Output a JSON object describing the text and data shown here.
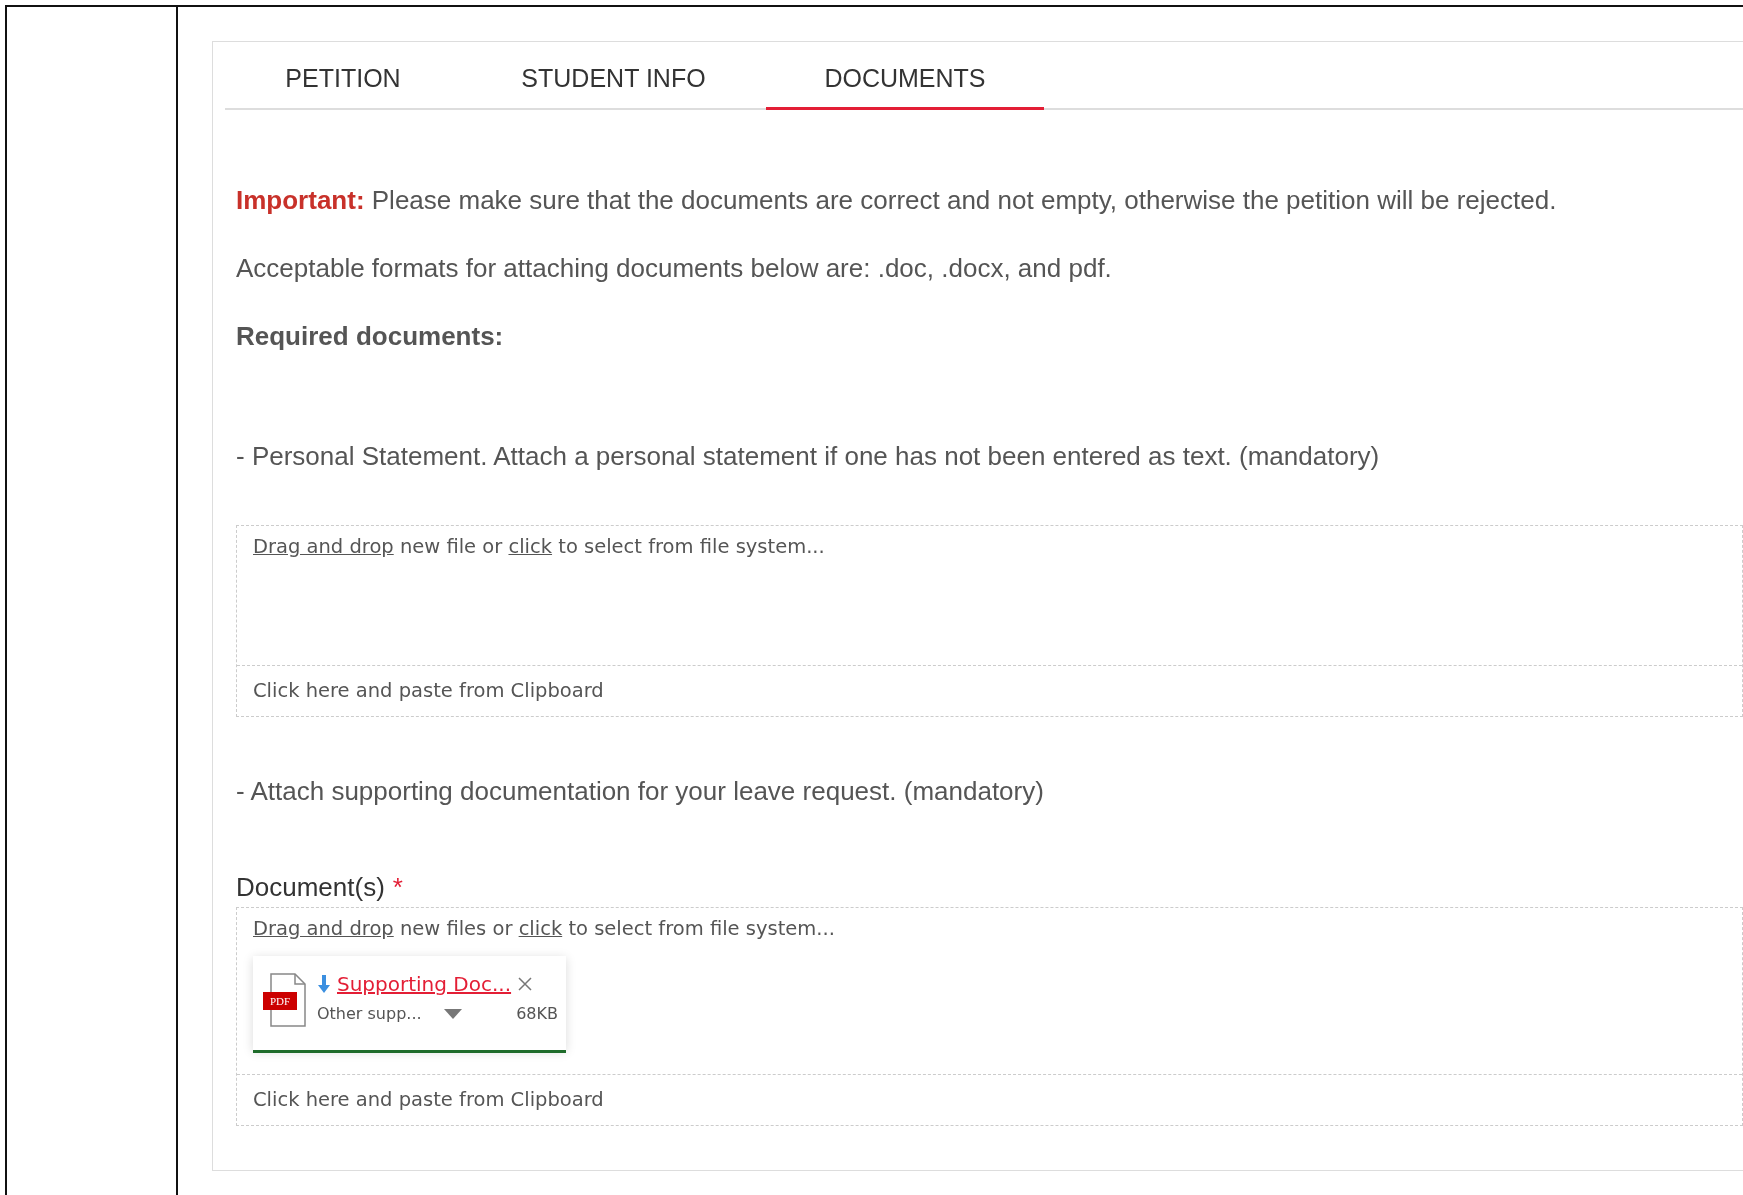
{
  "tabs": [
    {
      "label": "PETITION",
      "selected": false
    },
    {
      "label": "STUDENT INFO",
      "selected": false
    },
    {
      "label": "DOCUMENTS",
      "selected": true
    }
  ],
  "notice": "**Important:** Please make sure that the documents are correct and not empty, otherwise the petition will be rejected.",
  "formats_text": "Acceptable formats for attaching documents below are: .doc, .docx, and pdf.",
  "required_heading": "Required documents:",
  "sections": [
    {
      "description": "- Personal Statement. Attach a personal statement if one has not been entered as text. (mandatory)",
      "drop_hint": [
        {
          "kind": "link",
          "text": "Drag and drop"
        },
        {
          "kind": "text",
          "text": " new file or "
        },
        {
          "kind": "link",
          "text": "click"
        },
        {
          "kind": "text",
          "text": " to select from file system..."
        }
      ],
      "paste_hint": "Click here and paste from Clipboard"
    },
    {
      "description": "- Attach supporting documentation for your leave request. (mandatory)",
      "field_label": "Document(s)",
      "required_mark": "*",
      "drop_hint": [
        {
          "kind": "link",
          "text": "Drag and drop"
        },
        {
          "kind": "text",
          "text": " new files or "
        },
        {
          "kind": "link",
          "text": "click"
        },
        {
          "kind": "text",
          "text": " to select from file system..."
        }
      ],
      "paste_hint": "Click here and paste from Clipboard",
      "files": [
        {
          "type_label": "PDF",
          "name": "Supporting Doc...",
          "category": "Other supp...",
          "size": "68KB",
          "level": 1
        }
      ]
    }
  ]
}
